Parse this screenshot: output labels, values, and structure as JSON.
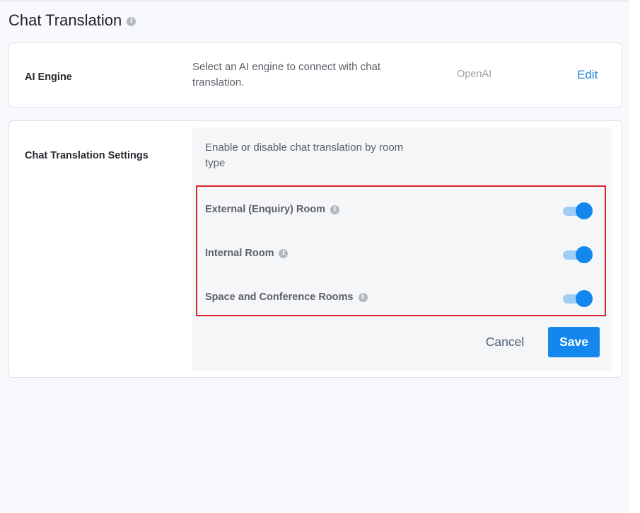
{
  "page": {
    "title": "Chat Translation"
  },
  "ai_engine": {
    "label": "AI Engine",
    "description": "Select an AI engine to connect with chat translation.",
    "value": "OpenAI",
    "edit_label": "Edit"
  },
  "settings": {
    "label": "Chat Translation Settings",
    "description": "Enable or disable chat translation by room type",
    "toggles": [
      {
        "label": "External (Enquiry) Room",
        "enabled": true
      },
      {
        "label": "Internal Room",
        "enabled": true
      },
      {
        "label": "Space and Conference Rooms",
        "enabled": true
      }
    ],
    "cancel_label": "Cancel",
    "save_label": "Save"
  },
  "colors": {
    "accent": "#1487ee",
    "toggle_track": "#9ecdf6",
    "highlight_border": "#d9262b",
    "page_background": "#f8f9fd"
  }
}
